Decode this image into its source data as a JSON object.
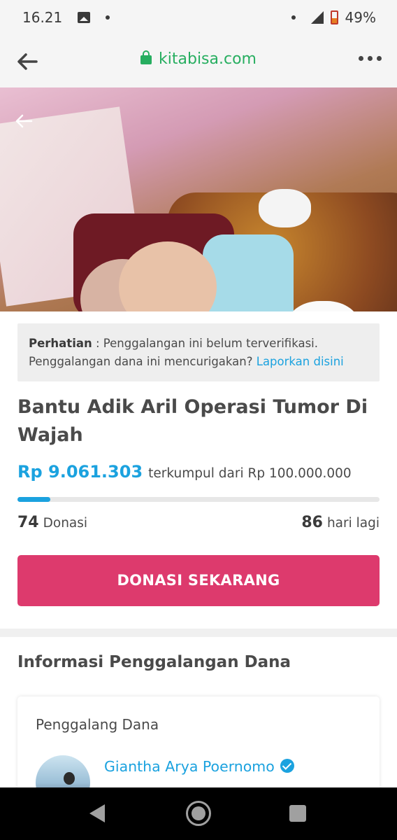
{
  "status_bar": {
    "time": "16.21",
    "battery": "49%"
  },
  "browser": {
    "url": "kitabisa.com",
    "icons": [
      "arrow-left-icon",
      "lock-icon",
      "more-dots-icon"
    ]
  },
  "hero": {
    "icon": "arrow-left-icon"
  },
  "warning": {
    "label": "Perhatian",
    "separator": " : ",
    "text": "Penggalangan ini belum terverifikasi. Penggalangan dana ini mencurigakan?",
    "link": "Laporkan disini"
  },
  "campaign": {
    "title": "Bantu Adik Aril Operasi Tumor Di Wajah",
    "collected": "Rp 9.061.303",
    "target_text": "terkumpul dari Rp 100.000.000",
    "progress_fraction": 0.09,
    "donations_count": "74",
    "donations_label": "Donasi",
    "days_left": "86",
    "days_label": "hari lagi",
    "donate_button": "DONASI SEKARANG"
  },
  "info": {
    "section_title": "Informasi Penggalangan Dana",
    "card_title": "Penggalang Dana",
    "fundraiser_name": "Giantha Arya Poernomo"
  },
  "colors": {
    "accent_blue": "#1ba2df",
    "donate_pink": "#dd3a6d",
    "url_green": "#27ae60"
  }
}
